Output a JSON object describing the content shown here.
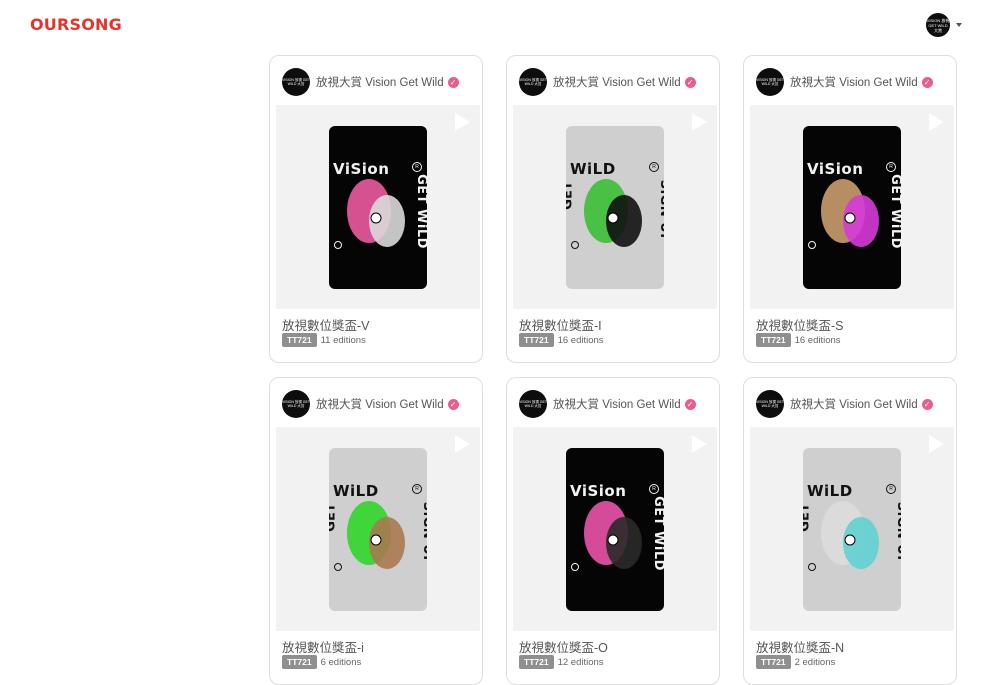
{
  "header": {
    "logo": "OURSONG",
    "account_avatar_text": "VISION 放視\nGET WILD 大賞"
  },
  "cards": [
    {
      "creator": "放視大賞 Vision Get Wild",
      "avatar_text": "VISION 放視\nGET WILD 大賞",
      "title": "放視數位獎盃-V",
      "tag": "TT721",
      "editions": "11 editions",
      "poster_theme": "dark",
      "poster_text_1": "ViSion",
      "poster_text_2": "GET WiLD",
      "poster_text_3": "",
      "art_colors": [
        "#e8589b",
        "#d9d9d9"
      ]
    },
    {
      "creator": "放視大賞 Vision Get Wild",
      "avatar_text": "VISION 放視\nGET WILD 大賞",
      "title": "放視數位獎盃-I",
      "tag": "TT721",
      "editions": "16 editions",
      "poster_theme": "light",
      "poster_text_1": "WiLD",
      "poster_text_2": "SiGN UP",
      "poster_text_3": "GET",
      "art_colors": [
        "#3fbf3a",
        "#111111"
      ]
    },
    {
      "creator": "放視大賞 Vision Get Wild",
      "avatar_text": "VISION 放視\nGET WILD 大賞",
      "title": "放視數位獎盃-S",
      "tag": "TT721",
      "editions": "16 editions",
      "poster_theme": "dark",
      "poster_text_1": "ViSion",
      "poster_text_2": "GET WiLD",
      "poster_text_3": "",
      "art_colors": [
        "#c79a6a",
        "#d63ad9"
      ]
    },
    {
      "creator": "放視大賞 Vision Get Wild",
      "avatar_text": "VISION 放視\nGET WILD 大賞",
      "title": "放視數位獎盃-i",
      "tag": "TT721",
      "editions": "6 editions",
      "poster_theme": "light",
      "poster_text_1": "WiLD",
      "poster_text_2": "SiGN UP",
      "poster_text_3": "GET",
      "art_colors": [
        "#33d62f",
        "#a97950"
      ]
    },
    {
      "creator": "放視大賞 Vision Get Wild",
      "avatar_text": "VISION 放視\nGET WILD 大賞",
      "title": "放視數位獎盃-O",
      "tag": "TT721",
      "editions": "12 editions",
      "poster_theme": "dark",
      "poster_text_1": "ViSion",
      "poster_text_2": "GET WiLD",
      "poster_text_3": "",
      "art_colors": [
        "#e651a6",
        "#2a2a2a"
      ]
    },
    {
      "creator": "放視大賞 Vision Get Wild",
      "avatar_text": "VISION 放視\nGET WILD 大賞",
      "title": "放視數位獎盃-N",
      "tag": "TT721",
      "editions": "2 editions",
      "poster_theme": "light",
      "poster_text_1": "WiLD",
      "poster_text_2": "SiGN UP",
      "poster_text_3": "GET",
      "art_colors": [
        "#dcdcdc",
        "#5fd0d0"
      ]
    }
  ]
}
